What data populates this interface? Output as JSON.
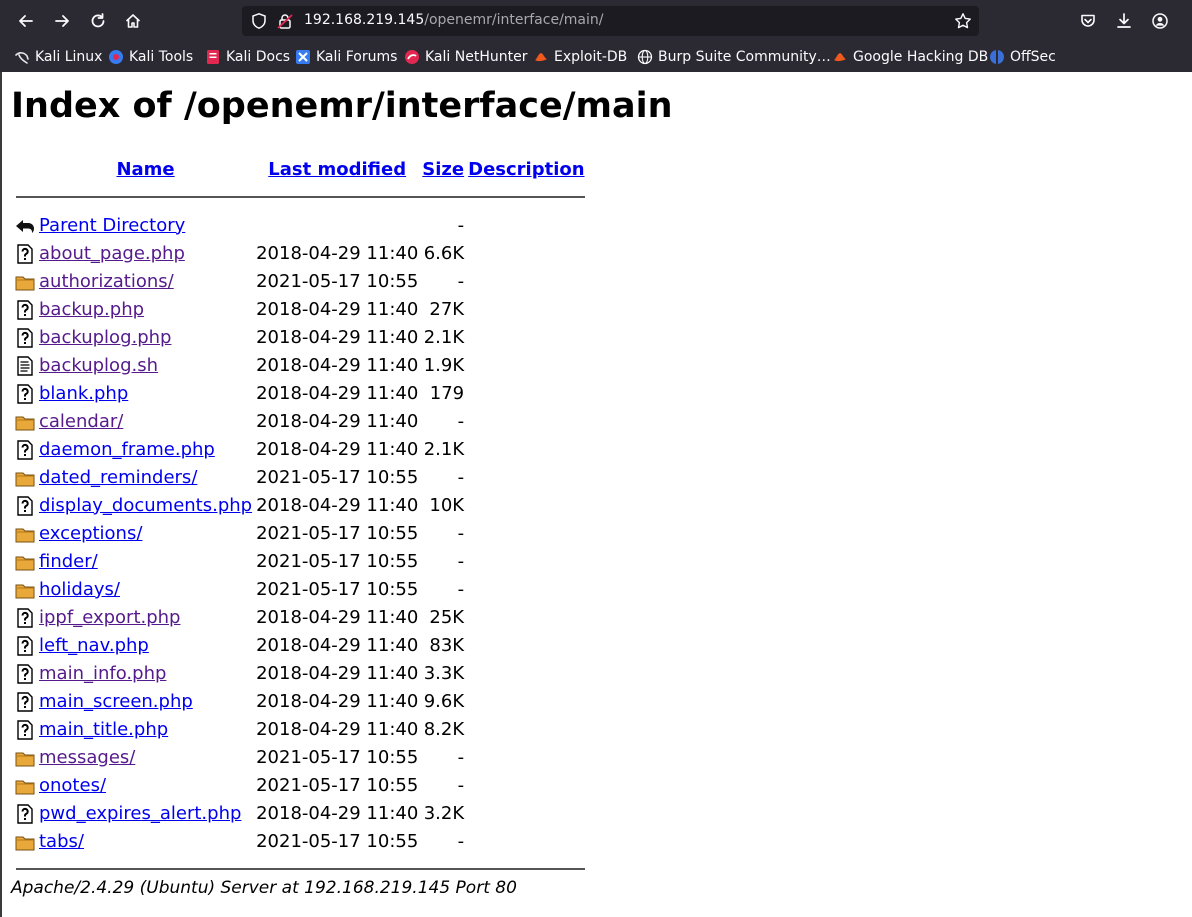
{
  "browser": {
    "url_host": "192.168.219.145",
    "url_path": "/openemr/interface/main/",
    "bookmarks": [
      {
        "label": "Kali Linux",
        "icon": "kali-dragon-icon"
      },
      {
        "label": "Kali Tools",
        "icon": "kali-tools-icon"
      },
      {
        "label": "Kali Docs",
        "icon": "kali-docs-icon"
      },
      {
        "label": "Kali Forums",
        "icon": "kali-forums-icon"
      },
      {
        "label": "Kali NetHunter",
        "icon": "kali-nethunter-icon"
      },
      {
        "label": "Exploit-DB",
        "icon": "exploit-db-icon"
      },
      {
        "label": "Burp Suite Community…",
        "icon": "globe-icon"
      },
      {
        "label": "Google Hacking DB",
        "icon": "ghdb-icon"
      },
      {
        "label": "OffSec",
        "icon": "offsec-icon"
      }
    ]
  },
  "page": {
    "title": "Index of /openemr/interface/main",
    "headers": {
      "name": "Name",
      "last_modified": "Last modified",
      "size": "Size",
      "description": "Description"
    },
    "parent": {
      "label": "Parent Directory",
      "size": "-"
    },
    "rows": [
      {
        "name": "about_page.php",
        "modified": "2018-04-29 11:40",
        "size": "6.6K",
        "type": "unknown",
        "visited": true
      },
      {
        "name": "authorizations/",
        "modified": "2021-05-17 10:55",
        "size": "-",
        "type": "folder",
        "visited": true
      },
      {
        "name": "backup.php",
        "modified": "2018-04-29 11:40",
        "size": "27K",
        "type": "unknown",
        "visited": true
      },
      {
        "name": "backuplog.php",
        "modified": "2018-04-29 11:40",
        "size": "2.1K",
        "type": "unknown",
        "visited": true
      },
      {
        "name": "backuplog.sh",
        "modified": "2018-04-29 11:40",
        "size": "1.9K",
        "type": "text",
        "visited": true
      },
      {
        "name": "blank.php",
        "modified": "2018-04-29 11:40",
        "size": "179",
        "type": "unknown",
        "visited": false
      },
      {
        "name": "calendar/",
        "modified": "2018-04-29 11:40",
        "size": "-",
        "type": "folder",
        "visited": true
      },
      {
        "name": "daemon_frame.php",
        "modified": "2018-04-29 11:40",
        "size": "2.1K",
        "type": "unknown",
        "visited": false
      },
      {
        "name": "dated_reminders/",
        "modified": "2021-05-17 10:55",
        "size": "-",
        "type": "folder",
        "visited": false
      },
      {
        "name": "display_documents.php",
        "modified": "2018-04-29 11:40",
        "size": "10K",
        "type": "unknown",
        "visited": false
      },
      {
        "name": "exceptions/",
        "modified": "2021-05-17 10:55",
        "size": "-",
        "type": "folder",
        "visited": false
      },
      {
        "name": "finder/",
        "modified": "2021-05-17 10:55",
        "size": "-",
        "type": "folder",
        "visited": false
      },
      {
        "name": "holidays/",
        "modified": "2021-05-17 10:55",
        "size": "-",
        "type": "folder",
        "visited": false
      },
      {
        "name": "ippf_export.php",
        "modified": "2018-04-29 11:40",
        "size": "25K",
        "type": "unknown",
        "visited": true
      },
      {
        "name": "left_nav.php",
        "modified": "2018-04-29 11:40",
        "size": "83K",
        "type": "unknown",
        "visited": false
      },
      {
        "name": "main_info.php",
        "modified": "2018-04-29 11:40",
        "size": "3.3K",
        "type": "unknown",
        "visited": true
      },
      {
        "name": "main_screen.php",
        "modified": "2018-04-29 11:40",
        "size": "9.6K",
        "type": "unknown",
        "visited": false
      },
      {
        "name": "main_title.php",
        "modified": "2018-04-29 11:40",
        "size": "8.2K",
        "type": "unknown",
        "visited": false
      },
      {
        "name": "messages/",
        "modified": "2021-05-17 10:55",
        "size": "-",
        "type": "folder",
        "visited": true
      },
      {
        "name": "onotes/",
        "modified": "2021-05-17 10:55",
        "size": "-",
        "type": "folder",
        "visited": false
      },
      {
        "name": "pwd_expires_alert.php",
        "modified": "2018-04-29 11:40",
        "size": "3.2K",
        "type": "unknown",
        "visited": false
      },
      {
        "name": "tabs/",
        "modified": "2021-05-17 10:55",
        "size": "-",
        "type": "folder",
        "visited": false
      }
    ],
    "footer": "Apache/2.4.29 (Ubuntu) Server at 192.168.219.145 Port 80"
  },
  "colors": {
    "chrome_bg": "#2b2a33",
    "urlbar_bg": "#1c1b22",
    "link": "#0000ee",
    "visited_link": "#551a8b"
  }
}
